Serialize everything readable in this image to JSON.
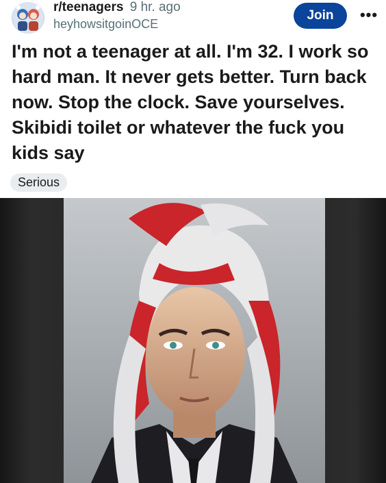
{
  "header": {
    "subreddit": "r/teenagers",
    "age": "9 hr. ago",
    "username": "heyhowsitgoinOCE",
    "join_label": "Join",
    "more_label": "•••",
    "avatar_icon": "subreddit-avatar-icon"
  },
  "post": {
    "title": "I'm not a teenager at all. I'm 32. I work so hard man. It never gets better. Turn back now. Stop the clock. Save yourselves. Skibidi toilet or whatever the fuck you kids say",
    "flair": "Serious"
  },
  "colors": {
    "join_bg": "#0a449b",
    "text_primary": "#1a1a1b",
    "text_meta": "#576f76",
    "flair_bg": "#eaedef",
    "media_bg": "#2a2a2a"
  }
}
